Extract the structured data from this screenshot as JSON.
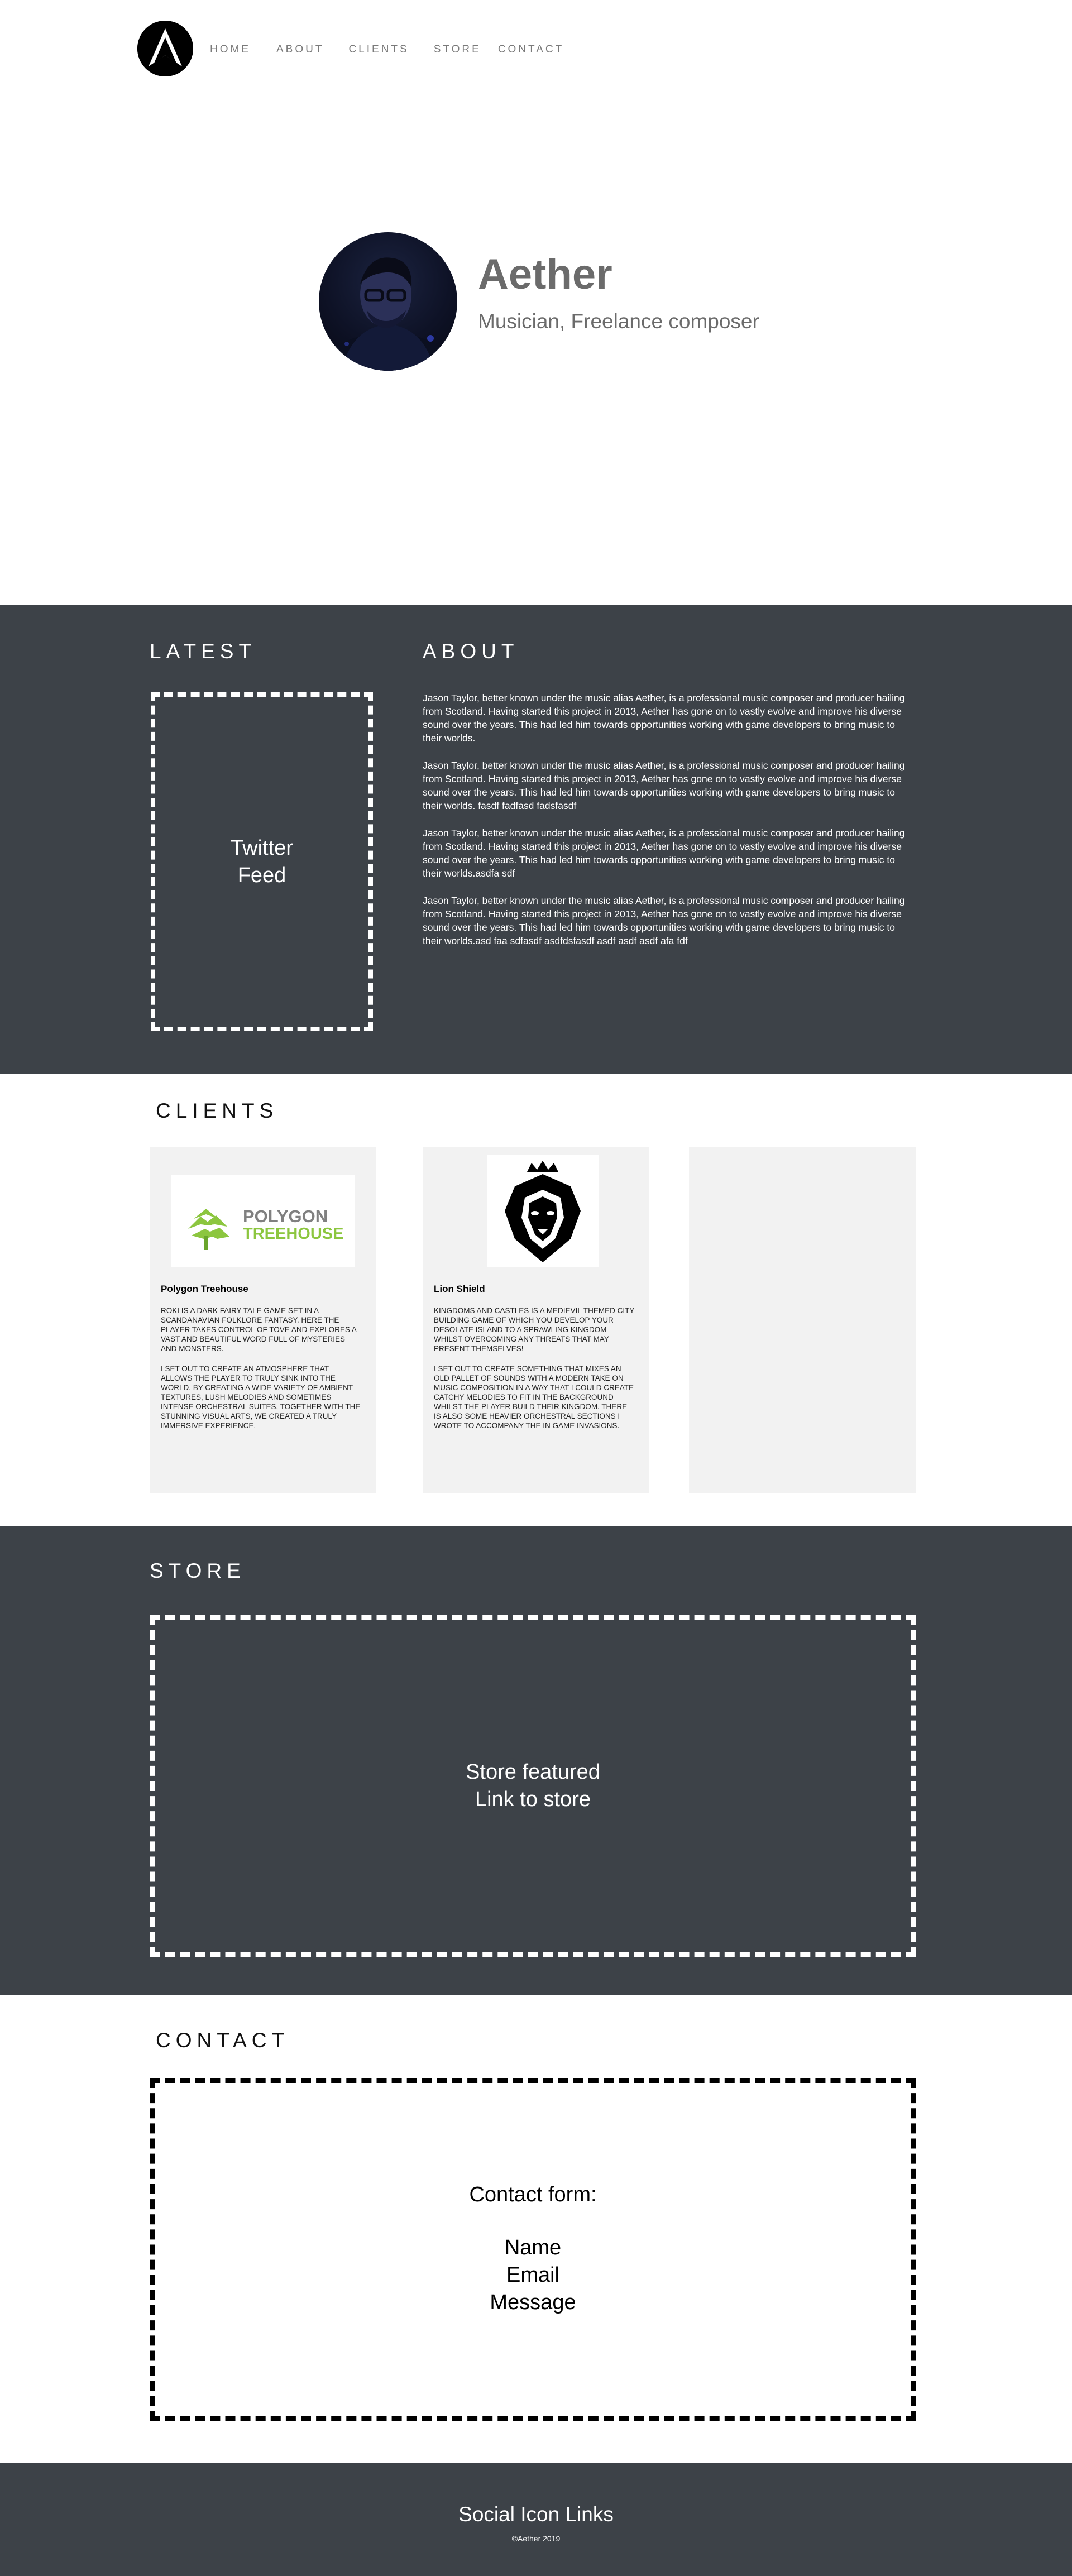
{
  "nav": {
    "items": [
      "HOME",
      "ABOUT",
      "CLIENTS",
      "STORE",
      "CONTACT"
    ]
  },
  "hero": {
    "name": "Aether",
    "subtitle": "Musician, Freelance composer"
  },
  "latest": {
    "title": "LATEST",
    "placeholder": "Twitter\nFeed"
  },
  "about": {
    "title": "ABOUT",
    "paragraphs": [
      "Jason Taylor, better known under the music alias Aether, is a professional music composer and producer hailing from Scotland. Having started this project in 2013, Aether has gone on to vastly evolve and improve his diverse sound over the years. This had led him towards opportunities working with game developers to bring music to their worlds.",
      "Jason Taylor, better known under the music alias Aether, is a professional music composer and producer hailing from Scotland. Having started this project in 2013, Aether has gone on to vastly evolve and improve his diverse sound over the years. This had led him towards opportunities working with game developers to bring music to their worlds. fasdf fadfasd fadsfasdf",
      "Jason Taylor, better known under the music alias Aether, is a professional music composer and producer hailing from Scotland. Having started this project in 2013, Aether has gone on to vastly evolve and improve his diverse sound over the years. This had led him towards opportunities working with game developers to bring music to their worlds.asdfa sdf",
      "Jason Taylor, better known under the music alias Aether, is a professional music composer and producer hailing from Scotland. Having started this project in 2013, Aether has gone on to vastly evolve and improve his diverse sound over the years. This had led him towards opportunities working with game developers to bring music to their worlds.asd faa sdfasdf asdfdsfasdf asdf asdf asdf afa fdf"
    ]
  },
  "clients": {
    "title": "CLIENTS",
    "cards": [
      {
        "name": "Polygon Treehouse",
        "logo_text_1": "POLYGON",
        "logo_text_2": "TREEHOUSE",
        "desc_1": "Roki is a dark fairy tale game set in a Scandanavian folklore fantasy. Here the player takes control of Tove and explores a vast and beautiful word full of mysteries and monsters.",
        "desc_2": "I set out to create an atmosphere that allows the player to truly sink into the world. By creating a wide variety of ambient textures, lush melodies and sometimes intense orchestral suites, together with the stunning visual arts, we created a truly immersive experience."
      },
      {
        "name": "Lion Shield",
        "desc_1": "Kingdoms and Castles is a medievil themed city building game of which you develop your desolate island to a sprawling kingdom whilst overcoming any threats that may present themselves!",
        "desc_2": "I set out to create something that mixes an old pallet of sounds with a modern take on music composition in a way that I could create catchy melodies to fit in the background whilst the player build their kingdom. There is also some heavier orchestral sections I wrote to accompany the in game invasions."
      }
    ]
  },
  "store": {
    "title": "STORE",
    "placeholder": "Store featured\nLink to store"
  },
  "contact": {
    "title": "CONTACT",
    "form_title": "Contact form:",
    "fields": [
      "Name",
      "Email",
      "Message"
    ]
  },
  "footer": {
    "title": "Social Icon Links",
    "copyright": "©Aether 2019"
  },
  "colors": {
    "dark_section": "#3d4248",
    "card_bg": "#f2f2f2",
    "polygon_green": "#8cc63f",
    "polygon_gray": "#808080"
  }
}
